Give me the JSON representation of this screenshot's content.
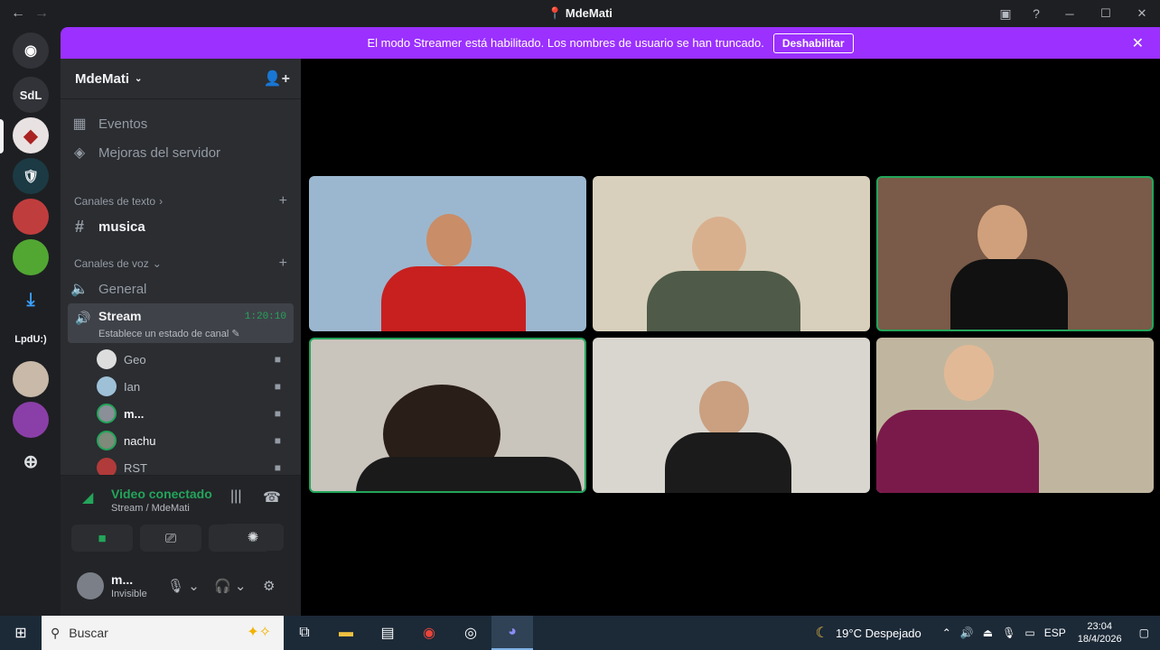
{
  "window": {
    "title": "MdeMati",
    "back": "←",
    "forward": "→"
  },
  "guilds": [
    {
      "label": "",
      "kind": "discord-home"
    },
    {
      "label": "SdL"
    },
    {
      "label": ""
    },
    {
      "label": ""
    },
    {
      "label": ""
    },
    {
      "label": ""
    },
    {
      "label": ""
    },
    {
      "label": "LpdU:)"
    },
    {
      "label": ""
    },
    {
      "label": ""
    }
  ],
  "banner": {
    "text": "El modo Streamer está habilitado. Los nombres de usuario se han truncado.",
    "button": "Deshabilitar"
  },
  "server": {
    "name": "MdeMati"
  },
  "sidebar": {
    "events": "Eventos",
    "boosts": "Mejoras del servidor",
    "text_category": "Canales de texto",
    "text_channel": "musica",
    "voice_category": "Canales de voz",
    "voice_general": "General",
    "voice_stream": "Stream",
    "stream_time": "1:20:10",
    "stream_status": "Establece un estado de canal",
    "users": [
      {
        "name": "Geo",
        "speaking": false
      },
      {
        "name": "Ian",
        "speaking": false
      },
      {
        "name": "m...",
        "speaking": true
      },
      {
        "name": "nachu",
        "speaking": true
      },
      {
        "name": "RST",
        "speaking": false
      }
    ]
  },
  "voice_panel": {
    "title": "Video conectado",
    "subtitle": "Stream / MdeMati"
  },
  "user_panel": {
    "name": "m...",
    "status": "Invisible"
  },
  "video_tiles": [
    {
      "bg": "#9bb7cf",
      "shirt": "#c8201f",
      "speaking": false
    },
    {
      "bg": "#d8d0bc",
      "shirt": "#4f5a48",
      "speaking": false
    },
    {
      "bg": "#7a5a48",
      "shirt": "#111111",
      "speaking": true
    },
    {
      "bg": "#c9c4bc",
      "shirt": "#1a1a1a",
      "speaking": true
    },
    {
      "bg": "#d9d6cf",
      "shirt": "#1b1b1b",
      "speaking": false
    },
    {
      "bg": "#c0b69f",
      "shirt": "#7a1a4a",
      "speaking": false
    }
  ],
  "taskbar": {
    "search_placeholder": "Buscar",
    "weather": "19°C  Despejado",
    "lang": "ESP",
    "time": "23:04",
    "date": "18/4/2026"
  },
  "colors": {
    "accent_green": "#23a55a",
    "banner": "#9b30ff",
    "bg": "#1e1f22"
  }
}
